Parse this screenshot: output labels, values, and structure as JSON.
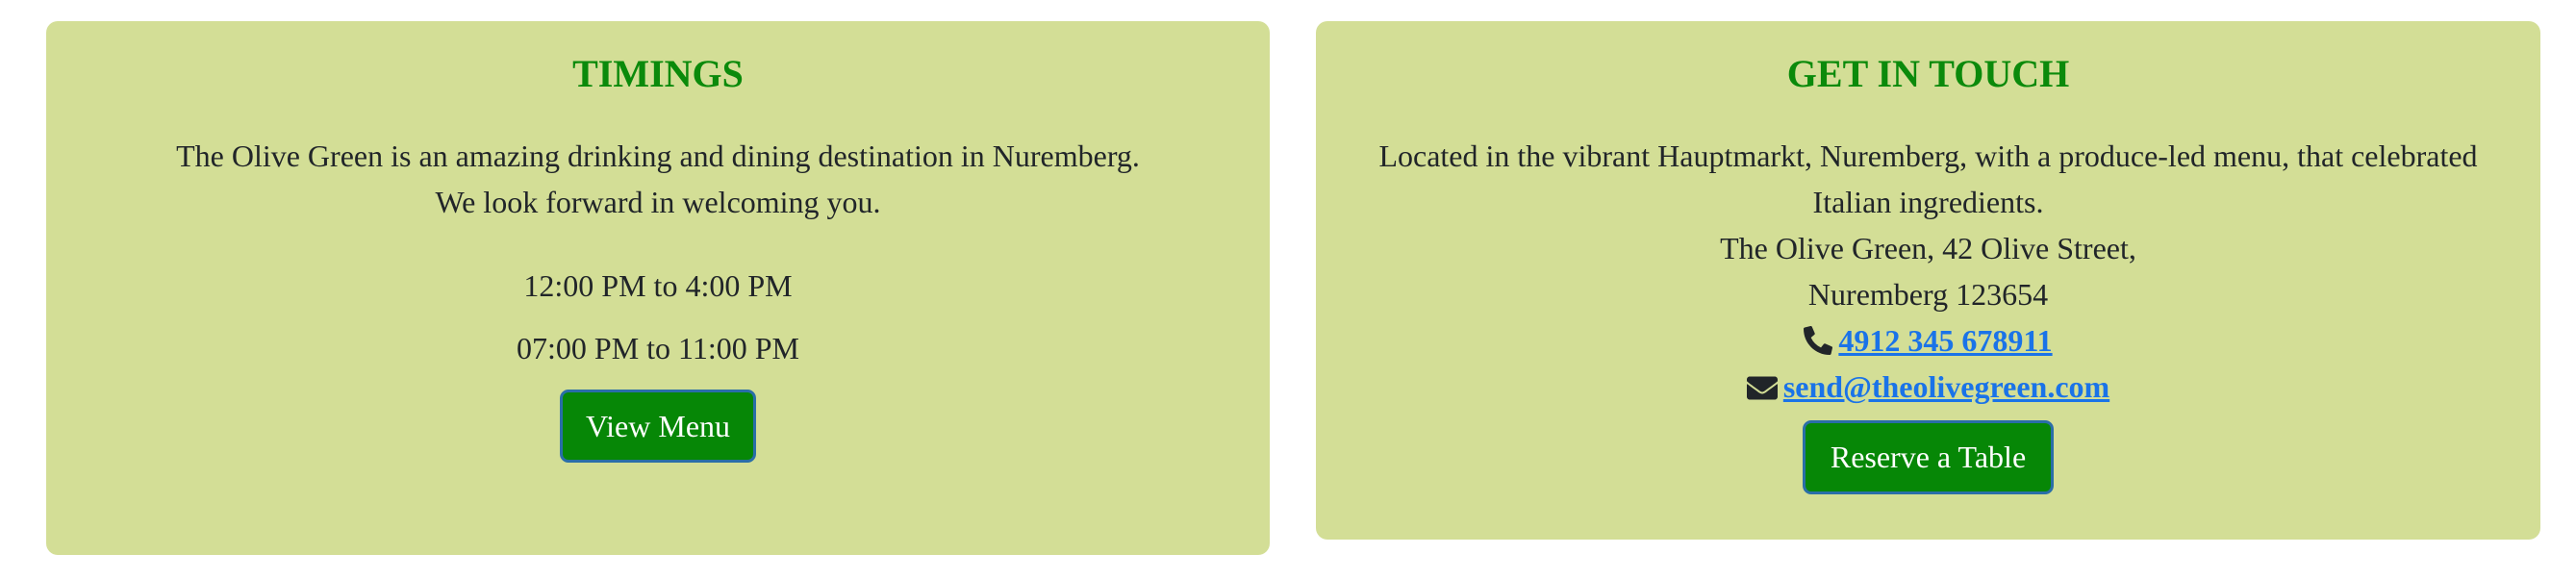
{
  "timings": {
    "title": "TIMINGS",
    "description_line1": "The Olive Green is an amazing drinking and dining destination in Nuremberg.",
    "description_line2": "We look forward in welcoming you.",
    "slot1": "12:00 PM to 4:00 PM",
    "slot2": "07:00 PM to 11:00 PM",
    "menu_button": "View Menu"
  },
  "contact": {
    "title": "GET IN TOUCH",
    "intro_line1": "Located in the vibrant Hauptmarkt, Nuremberg, with a produce-led menu, that celebrated",
    "intro_line2": "Italian ingredients.",
    "address_line1": "The Olive Green, 42 Olive Street,",
    "address_line2": "Nuremberg 123654",
    "phone": "4912 345 678911",
    "phone_icon": "phone-icon",
    "email": "send@theolivegreen.com",
    "email_icon": "envelope-icon",
    "reserve_button": "Reserve a Table"
  },
  "colors": {
    "card_bg": "#d3de96",
    "heading": "#0b8a0b",
    "button_bg": "#068706",
    "link": "#1a73e8"
  }
}
